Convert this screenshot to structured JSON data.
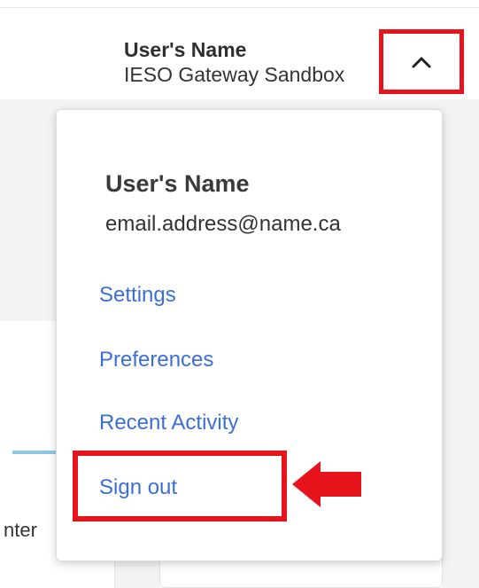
{
  "header": {
    "user_name": "User's Name",
    "org_name": "IESO Gateway Sandbox"
  },
  "menu": {
    "user_name": "User's Name",
    "email": "email.address@name.ca",
    "items": [
      {
        "label": "Settings"
      },
      {
        "label": "Preferences"
      },
      {
        "label": "Recent Activity"
      },
      {
        "label": "Sign out"
      }
    ]
  },
  "background": {
    "partial_text": "nter"
  },
  "colors": {
    "highlight": "#e8141c",
    "link": "#3b6fd6",
    "progress": "#8cc8e6"
  },
  "icons": {
    "toggle": "chevron-up-icon",
    "pointer": "arrow-left-icon"
  }
}
